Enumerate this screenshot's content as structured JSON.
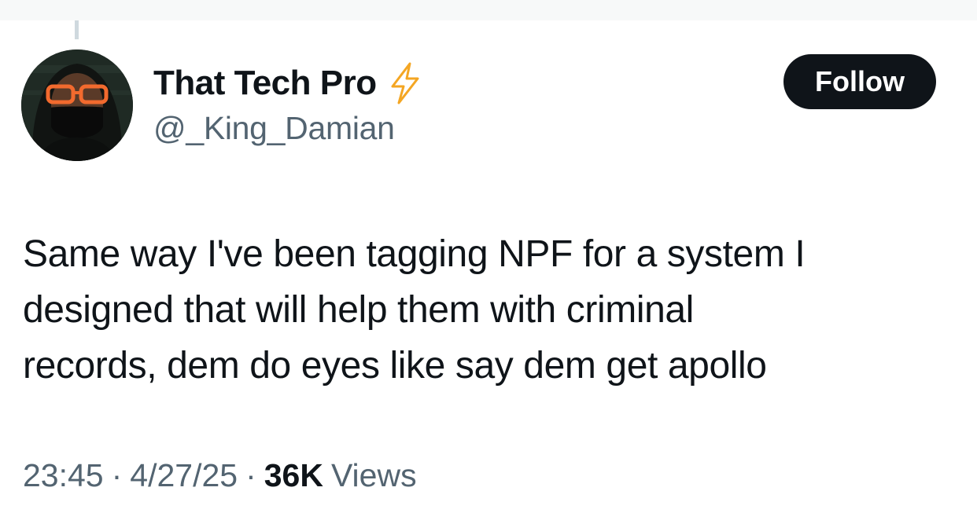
{
  "tweet": {
    "author": {
      "display_name": "That Tech Pro",
      "handle": "@_King_Damian",
      "badge_icon": "high-voltage-icon"
    },
    "follow_label": "Follow",
    "text_lines": [
      "Same way I've been tagging NPF for a system I",
      "designed that will help them with criminal",
      "records, dem do eyes like say dem get apollo"
    ],
    "meta": {
      "time": "23:45",
      "separator": "·",
      "date": "4/27/25",
      "views_count": "36K",
      "views_label": "Views"
    }
  },
  "colors": {
    "text_primary": "#0f1419",
    "text_secondary": "#536471",
    "follow_bg": "#0f1419",
    "accent_orange": "#f4900c"
  }
}
